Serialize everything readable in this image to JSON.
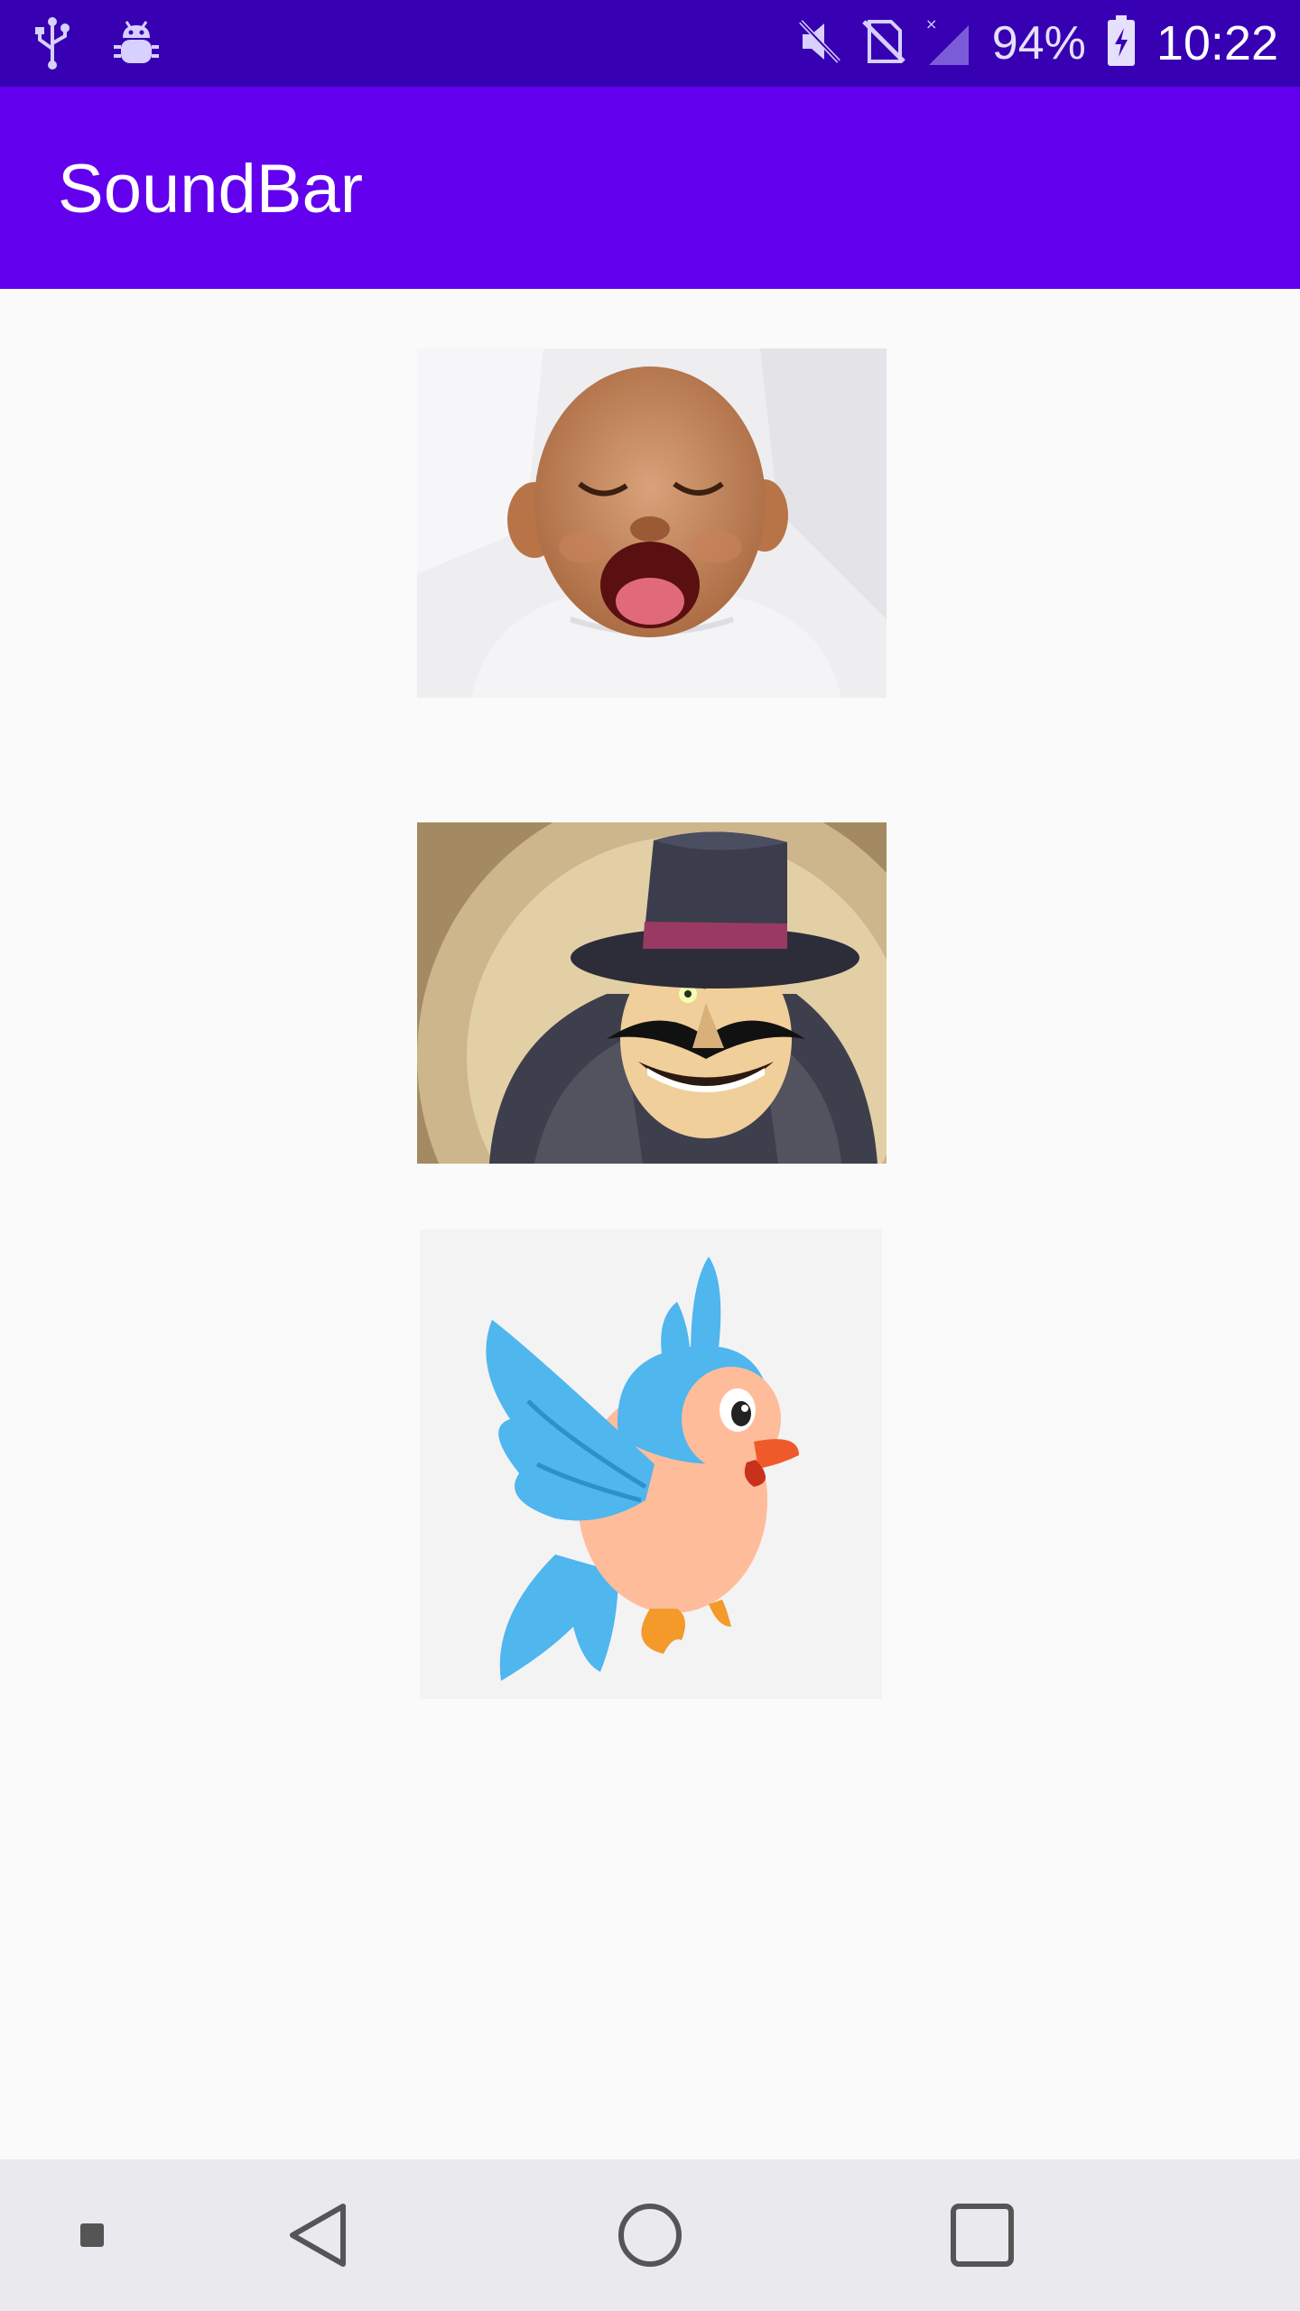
{
  "status_bar": {
    "left_icons": [
      "usb-icon",
      "android-debug-icon"
    ],
    "right_icons": [
      "mute-icon",
      "no-sim-icon",
      "signal-icon",
      "battery-icon"
    ],
    "battery_percent": "94%",
    "time": "10:22"
  },
  "app_bar": {
    "title": "SoundBar",
    "color": "#6200ee",
    "status_color": "#3700b3"
  },
  "sounds": [
    {
      "name": "laughing-baby",
      "icon": "laughing-baby-image"
    },
    {
      "name": "villain",
      "icon": "villain-image"
    },
    {
      "name": "bird",
      "icon": "bird-image"
    }
  ],
  "nav_bar": {
    "items": [
      "recent-apps-small-icon",
      "back-icon",
      "home-icon",
      "overview-icon"
    ]
  }
}
